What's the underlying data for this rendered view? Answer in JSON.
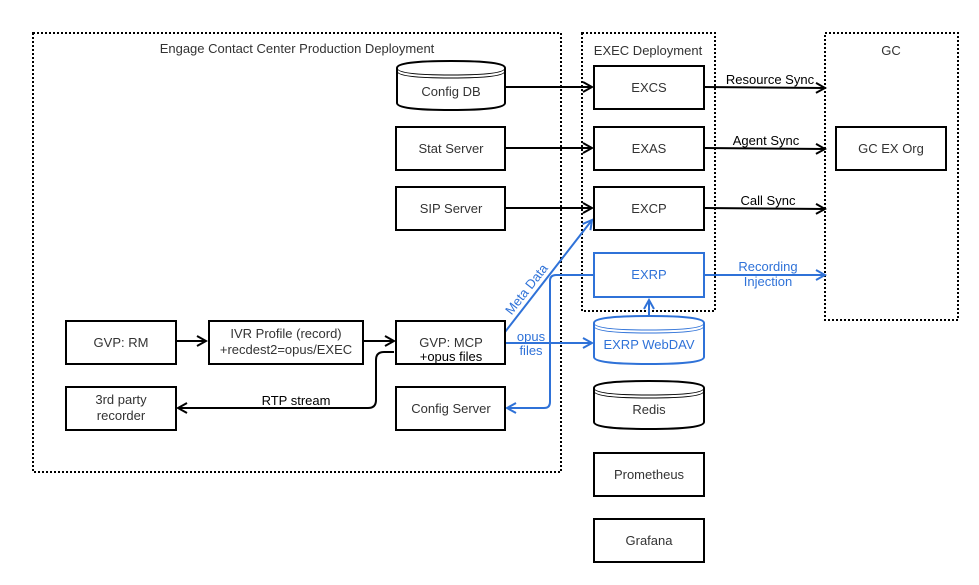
{
  "groups": {
    "engage": "Engage Contact Center Production Deployment",
    "exec": "EXEC Deployment",
    "gc": "GC"
  },
  "nodes": {
    "config_db": "Config DB",
    "stat_server": "Stat Server",
    "sip_server": "SIP Server",
    "gvp_rm": "GVP: RM",
    "ivr_profile_line1": "IVR Profile (record)",
    "ivr_profile_line2": "+recdest2=opus/EXEC",
    "gvp_mcp_line1": "GVP: MCP",
    "gvp_mcp_line2": "+opus files",
    "third_party_line1": "3rd party",
    "third_party_line2": "recorder",
    "config_server": "Config Server",
    "excs": "EXCS",
    "exas": "EXAS",
    "excp": "EXCP",
    "exrp": "EXRP",
    "exrp_webdav": "EXRP WebDAV",
    "redis": "Redis",
    "prometheus": "Prometheus",
    "grafana": "Grafana",
    "gc_ex_org": "GC EX Org"
  },
  "edges": {
    "resource_sync": "Resource Sync",
    "agent_sync": "Agent Sync",
    "call_sync": "Call Sync",
    "recording_injection_line1": "Recording",
    "recording_injection_line2": "Injection",
    "meta_data": "Meta Data",
    "opus_files_line1": "opus",
    "opus_files_line2": "files",
    "rtp_stream": "RTP stream"
  },
  "colors": {
    "primary": "#000000",
    "accent": "#2f72d8"
  }
}
